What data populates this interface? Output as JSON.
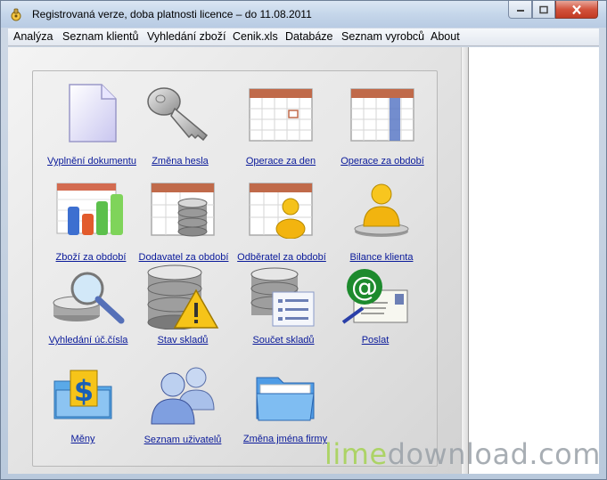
{
  "window": {
    "title": "Registrovaná verze, doba platnosti licence – do  11.08.2011",
    "controls": [
      "minimize-icon",
      "maximize-icon",
      "close-icon"
    ]
  },
  "menu": {
    "items": [
      "Analýza",
      "Seznam klientů",
      "Vyhledání zboží",
      "Cenik.xls",
      "Databáze",
      "Seznam vyrobců",
      "About"
    ]
  },
  "tiles": [
    {
      "label": "Vyplnění dokumentu",
      "icon": "document-icon"
    },
    {
      "label": "Změna hesla",
      "icon": "key-icon"
    },
    {
      "label": "Operace za den",
      "icon": "calendar-day-icon"
    },
    {
      "label": "Operace za období",
      "icon": "calendar-period-icon"
    },
    {
      "label": "Zboží za období",
      "icon": "bar-chart-icon"
    },
    {
      "label": "Dodavatel za období",
      "icon": "calendar-database-icon"
    },
    {
      "label": "Odběratel za období",
      "icon": "calendar-user-icon"
    },
    {
      "label": "Bilance klienta",
      "icon": "user-icon"
    },
    {
      "label": "Vyhledání úč.čísla",
      "icon": "magnifier-database-icon"
    },
    {
      "label": "Stav skladů",
      "icon": "database-warning-icon"
    },
    {
      "label": "Součet skladů",
      "icon": "database-list-icon"
    },
    {
      "label": "Poslat",
      "icon": "email-icon"
    },
    {
      "label": "Měny",
      "icon": "dollar-folder-icon"
    },
    {
      "label": "Seznam uživatelů",
      "icon": "users-icon"
    },
    {
      "label": "Změna jména firmy",
      "icon": "folder-icon"
    }
  ],
  "watermark": {
    "part1": "lime",
    "part2": "download.com"
  }
}
